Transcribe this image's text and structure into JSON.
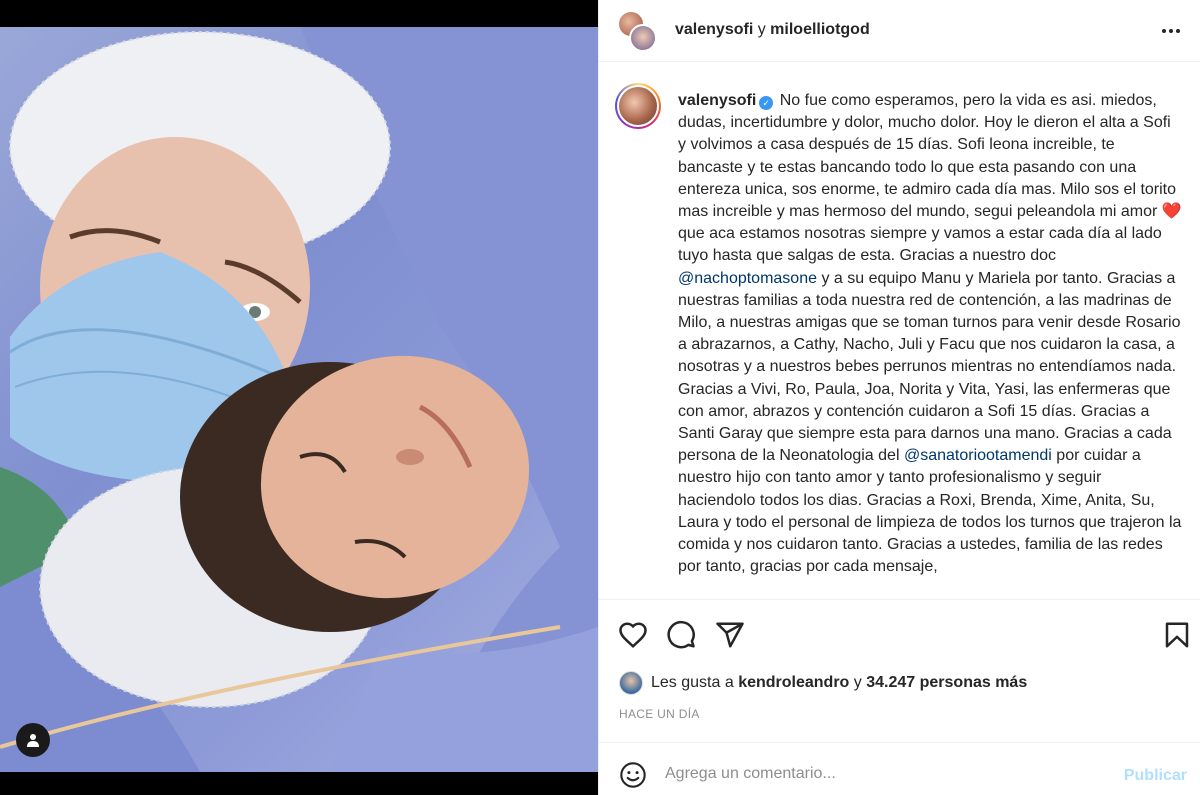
{
  "post": {
    "header": {
      "user1": "valenysofi",
      "conjunction": "y",
      "user2": "miloelliotgod",
      "more_icon": "more-horizontal-icon"
    },
    "caption": {
      "username": "valenysofi",
      "verified": true,
      "part1": "No fue como esperamos, pero la vida es asi. miedos, dudas, incertidumbre y dolor, mucho dolor. Hoy le dieron el alta a Sofi y volvimos a casa después de 15 días. Sofi leona increible, te bancaste y te estas bancando todo lo que esta pasando con una entereza unica, sos enorme, te admiro cada día mas. Milo sos el torito mas increible y mas hermoso del mundo, segui peleandola mi amor",
      "heart": "❤️",
      "part2": "que aca estamos nosotras siempre y vamos a estar cada día al lado tuyo hasta que salgas de esta. Gracias a nuestro doc",
      "mention1": "@nachoptomasone",
      "part3": "y a su equipo Manu y Mariela por tanto. Gracias a nuestras familias a toda nuestra red de contención, a las madrinas de Milo, a nuestras amigas que se toman turnos para venir desde Rosario a abrazarnos, a Cathy, Nacho, Juli y Facu que nos cuidaron la casa, a nosotras y a nuestros bebes perrunos mientras no entendíamos nada. Gracias a Vivi, Ro, Paula, Joa, Norita y Vita, Yasi, las enfermeras que con amor, abrazos y contención cuidaron a Sofi 15 días. Gracias a Santi Garay que siempre esta para darnos una mano. Gracias a cada persona de la Neonatologia del",
      "mention2": "@sanatoriootamendi",
      "part4": "por cuidar a nuestro hijo con tanto amor y tanto profesionalismo y seguir haciendolo todos los dias. Gracias a Roxi, Brenda, Xime, Anita, Su, Laura y todo el personal de limpieza de todos los turnos que trajeron la comida y nos cuidaron tanto. Gracias a ustedes, familia de las redes por tanto, gracias por cada mensaje,"
    },
    "likes": {
      "prefix": "Les gusta a",
      "user": "kendroleandro",
      "conjunction": "y",
      "count_text": "34.247 personas más"
    },
    "timestamp": "HACE UN DÍA",
    "comment": {
      "placeholder": "Agrega un comentario...",
      "publish_label": "Publicar"
    },
    "colors": {
      "link": "#00376b",
      "verified": "#3897f0",
      "publish_disabled": "#b2dffc",
      "muted": "#8e8e8e"
    }
  }
}
